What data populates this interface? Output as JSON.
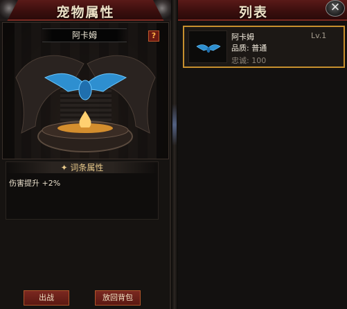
{
  "left_panel": {
    "title": "宠物属性",
    "pet_name": "阿卡姆",
    "help_label": "?",
    "attributes_title": "✦ 词条属性",
    "attributes": [
      {
        "text": "伤害提升  +2%"
      }
    ],
    "buttons": {
      "deploy": "出战",
      "return_to_bag": "放回背包"
    }
  },
  "right_panel": {
    "title": "列表",
    "close_label": "✕",
    "pets": [
      {
        "name": "阿卡姆",
        "level": "Lv.1",
        "quality": "品质: 普通",
        "loyalty": "忠诚: 100"
      }
    ]
  },
  "colors": {
    "header_red": "#5a1a18",
    "accent_gold": "#c8902e",
    "button_red": "#7a2820",
    "pet_blue": "#2e8fd0"
  }
}
